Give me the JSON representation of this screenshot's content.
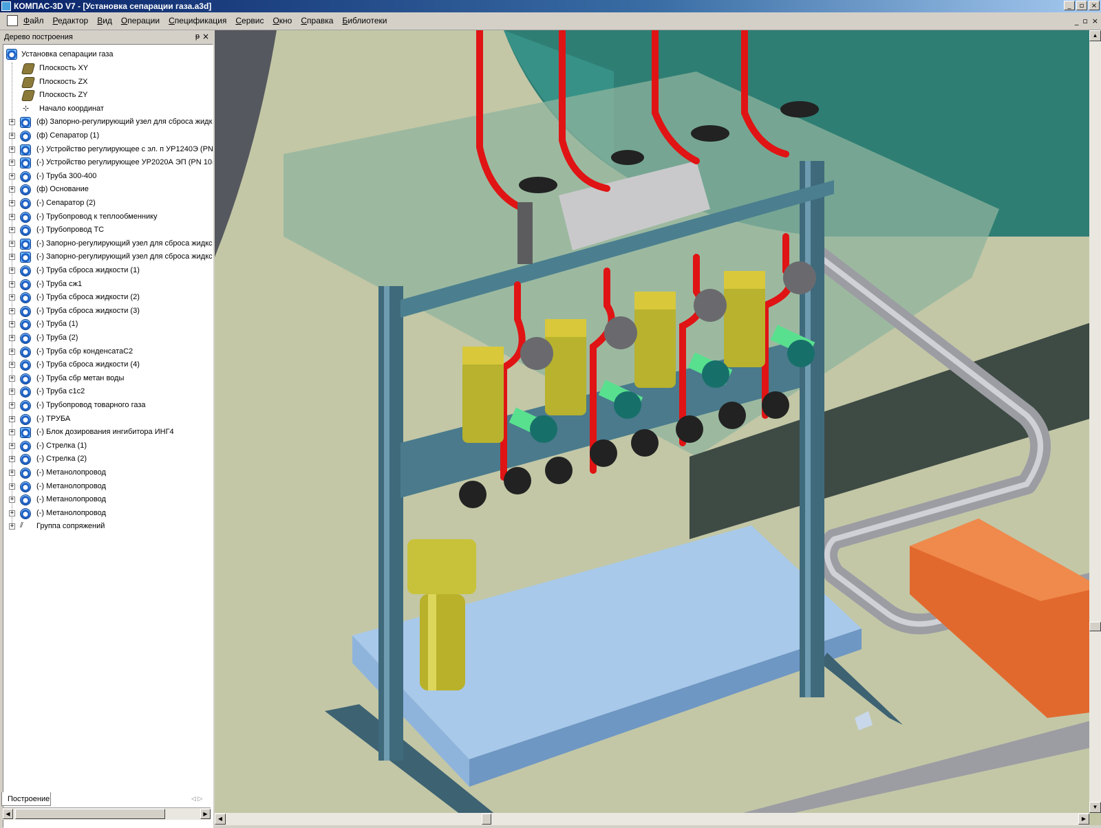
{
  "window": {
    "title": "КОМПАС-3D V7 - [Установка сепарации газа.a3d]",
    "controls": [
      "_",
      "▫",
      "×"
    ]
  },
  "menu": {
    "items": [
      "Файл",
      "Редактор",
      "Вид",
      "Операции",
      "Спецификация",
      "Сервис",
      "Окно",
      "Справка",
      "Библиотеки"
    ],
    "doc_controls": [
      "_",
      "▫",
      "×"
    ]
  },
  "tree_panel": {
    "title": "Дерево построения",
    "pin": "ᵽ",
    "close": "×",
    "tab_label": "Построение",
    "root": {
      "label": "Установка сепарации газа",
      "icon": "assembly-icon"
    },
    "items": [
      {
        "label": "Плоскость XY",
        "icon": "plane-icon",
        "expandable": false
      },
      {
        "label": "Плоскость ZX",
        "icon": "plane-icon",
        "expandable": false
      },
      {
        "label": "Плоскость ZY",
        "icon": "plane-icon",
        "expandable": false
      },
      {
        "label": "Начало координат",
        "icon": "origin-icon",
        "expandable": false
      },
      {
        "label": "(ф) Запорно-регулирующий узел для сброса жидк",
        "icon": "assembly-icon",
        "expandable": true
      },
      {
        "label": "(ф) Сепаратор (1)",
        "icon": "part-icon",
        "expandable": true
      },
      {
        "label": "(-) Устройство регулирующее с эл. п УР1240Э (PN",
        "icon": "assembly-icon",
        "expandable": true
      },
      {
        "label": "(-) Устройство регулирующее УР2020А ЭП (PN 10(",
        "icon": "assembly-icon",
        "expandable": true
      },
      {
        "label": "(-) Труба 300-400",
        "icon": "part-icon",
        "expandable": true
      },
      {
        "label": "(ф) Основание",
        "icon": "part-icon",
        "expandable": true
      },
      {
        "label": "(-) Сепаратор (2)",
        "icon": "part-icon",
        "expandable": true
      },
      {
        "label": "(-) Трубопровод к теплообменнику",
        "icon": "part-icon",
        "expandable": true
      },
      {
        "label": "(-) Трубопровод ТС",
        "icon": "part-icon",
        "expandable": true
      },
      {
        "label": "(-) Запорно-регулирующий узел для сброса жидкс",
        "icon": "assembly-icon",
        "expandable": true
      },
      {
        "label": "(-) Запорно-регулирующий узел для сброса жидкс",
        "icon": "assembly-icon",
        "expandable": true
      },
      {
        "label": "(-) Труба сброса жидкости (1)",
        "icon": "part-icon",
        "expandable": true
      },
      {
        "label": "(-) Труба сж1",
        "icon": "part-icon",
        "expandable": true
      },
      {
        "label": "(-) Труба сброса жидкости (2)",
        "icon": "part-icon",
        "expandable": true
      },
      {
        "label": "(-) Труба сброса жидкости (3)",
        "icon": "part-icon",
        "expandable": true
      },
      {
        "label": "(-) Труба (1)",
        "icon": "part-icon",
        "expandable": true
      },
      {
        "label": "(-) Труба (2)",
        "icon": "part-icon",
        "expandable": true
      },
      {
        "label": "(-) Труба сбр конденсатаС2",
        "icon": "part-icon",
        "expandable": true
      },
      {
        "label": "(-) Труба сброса жидкости (4)",
        "icon": "part-icon",
        "expandable": true
      },
      {
        "label": "(-) Труба сбр метан воды",
        "icon": "part-icon",
        "expandable": true
      },
      {
        "label": "(-) Труба с1с2",
        "icon": "part-icon",
        "expandable": true
      },
      {
        "label": "(-) Трубопровод товарного газа",
        "icon": "part-icon",
        "expandable": true
      },
      {
        "label": "(-) ТРУБА",
        "icon": "part-icon",
        "expandable": true
      },
      {
        "label": "(-) Блок дозирования ингибитора ИНГ4",
        "icon": "assembly-icon",
        "expandable": true
      },
      {
        "label": "(-) Стрелка (1)",
        "icon": "part-icon",
        "expandable": true
      },
      {
        "label": "(-) Стрелка (2)",
        "icon": "part-icon",
        "expandable": true
      },
      {
        "label": "(-) Метанолопровод",
        "icon": "part-icon",
        "expandable": true
      },
      {
        "label": "(-) Метанолопровод",
        "icon": "part-icon",
        "expandable": true
      },
      {
        "label": "(-) Метанолопровод",
        "icon": "part-icon",
        "expandable": true
      },
      {
        "label": "(-) Метанолопровод",
        "icon": "part-icon",
        "expandable": true
      },
      {
        "label": "Группа сопряжений",
        "icon": "mate-group-icon",
        "expandable": true
      }
    ]
  },
  "colors": {
    "viewport_background": "#c3c7a6",
    "vessel_teal": "#2e7d74",
    "steel_frame": "#4b7f8f",
    "tray_blue": "#a8c9ea",
    "valve_yellow": "#c8c23a",
    "pipe_red": "#e01414",
    "pipe_gray": "#a3a3a8",
    "block_orange": "#e2692e",
    "green_fitting": "#59e08f"
  }
}
